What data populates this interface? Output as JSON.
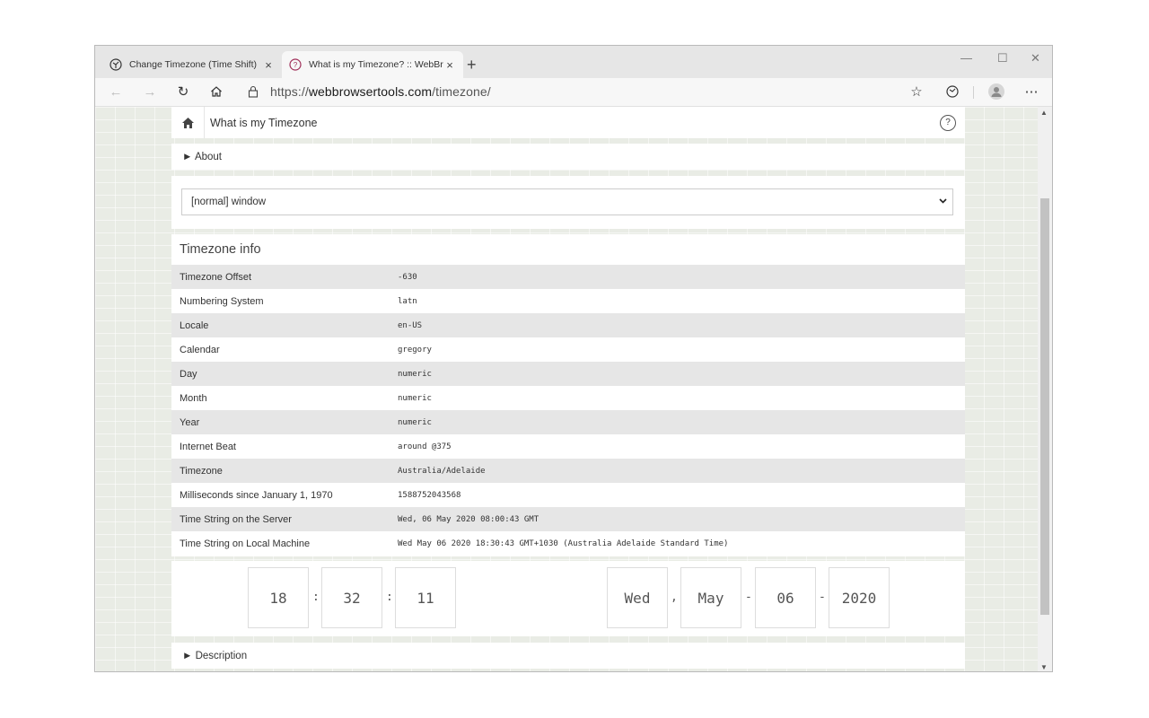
{
  "browser": {
    "tabs": [
      {
        "title": "Change Timezone (Time Shift)",
        "active": false,
        "close": "×"
      },
      {
        "title": "What is my Timezone? :: WebBro",
        "active": true,
        "close": "×"
      }
    ],
    "new_tab": "+",
    "window_controls": {
      "minimize": "—",
      "maximize": "☐",
      "close": "✕"
    },
    "url_prefix": "https://",
    "url_host": "webbrowsertools.com",
    "url_path": "/timezone/"
  },
  "page": {
    "header_title": "What is my Timezone",
    "about_label": "► About",
    "select_value": "[normal] window",
    "info_title": "Timezone info",
    "rows": [
      {
        "key": "Timezone Offset",
        "value": "-630"
      },
      {
        "key": "Numbering System",
        "value": "latn"
      },
      {
        "key": "Locale",
        "value": "en-US"
      },
      {
        "key": "Calendar",
        "value": "gregory"
      },
      {
        "key": "Day",
        "value": "numeric"
      },
      {
        "key": "Month",
        "value": "numeric"
      },
      {
        "key": "Year",
        "value": "numeric"
      },
      {
        "key": "Internet Beat",
        "value": "around @375"
      },
      {
        "key": "Timezone",
        "value": "Australia/Adelaide"
      },
      {
        "key": "Milliseconds since January 1, 1970",
        "value": "1588752043568"
      },
      {
        "key": "Time String on the Server",
        "value": "Wed, 06 May 2020 08:00:43 GMT"
      },
      {
        "key": "Time String on Local Machine",
        "value": "Wed May 06 2020 18:30:43 GMT+1030 (Australia Adelaide Standard Time)"
      }
    ],
    "clock": {
      "hours": "18",
      "minutes": "32",
      "seconds": "11",
      "weekday": "Wed",
      "month": "May",
      "day": "06",
      "year": "2020",
      "time_sep": ":",
      "comma": ",",
      "date_sep": "-"
    },
    "description_label": "► Description"
  }
}
